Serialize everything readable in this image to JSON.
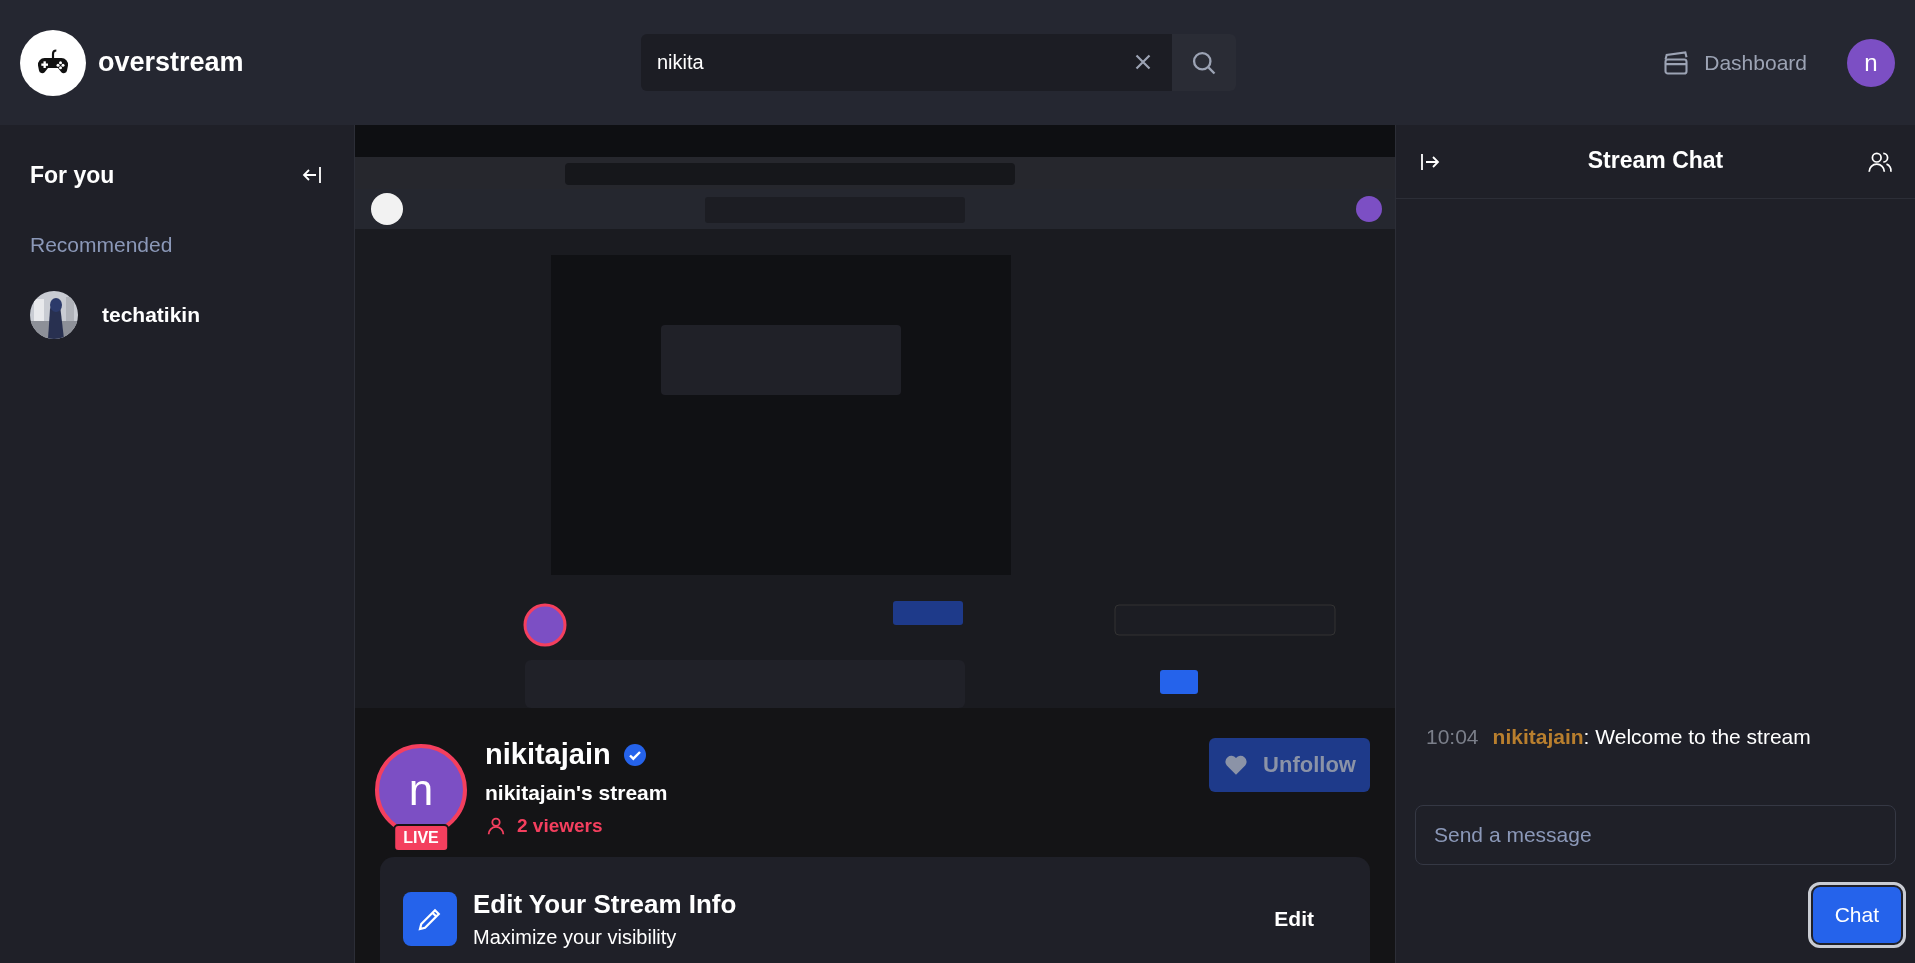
{
  "header": {
    "logo": "overstream",
    "search": {
      "value": "nikita"
    },
    "dashboard": "Dashboard",
    "avatar": "n"
  },
  "sidebar": {
    "title": "For you",
    "section": "Recommended",
    "items": [
      {
        "name": "techatikin",
        "kind": "picture"
      }
    ]
  },
  "stream": {
    "avatar": "n",
    "live": "LIVE",
    "name": "nikitajain",
    "verified": true,
    "title": "nikitajain's stream",
    "viewers": "2 viewers",
    "follow_button": "Unfollow",
    "info_card": {
      "title": "Edit Your Stream Info",
      "subtitle": "Maximize your visibility",
      "action": "Edit"
    }
  },
  "chat": {
    "title": "Stream Chat",
    "messages": [
      {
        "time": "10:04",
        "user": "nikitajain",
        "text": ": Welcome to the stream",
        "color": "#b97f2e"
      }
    ],
    "input": {
      "placeholder": "Send a message"
    },
    "send": "Chat"
  }
}
